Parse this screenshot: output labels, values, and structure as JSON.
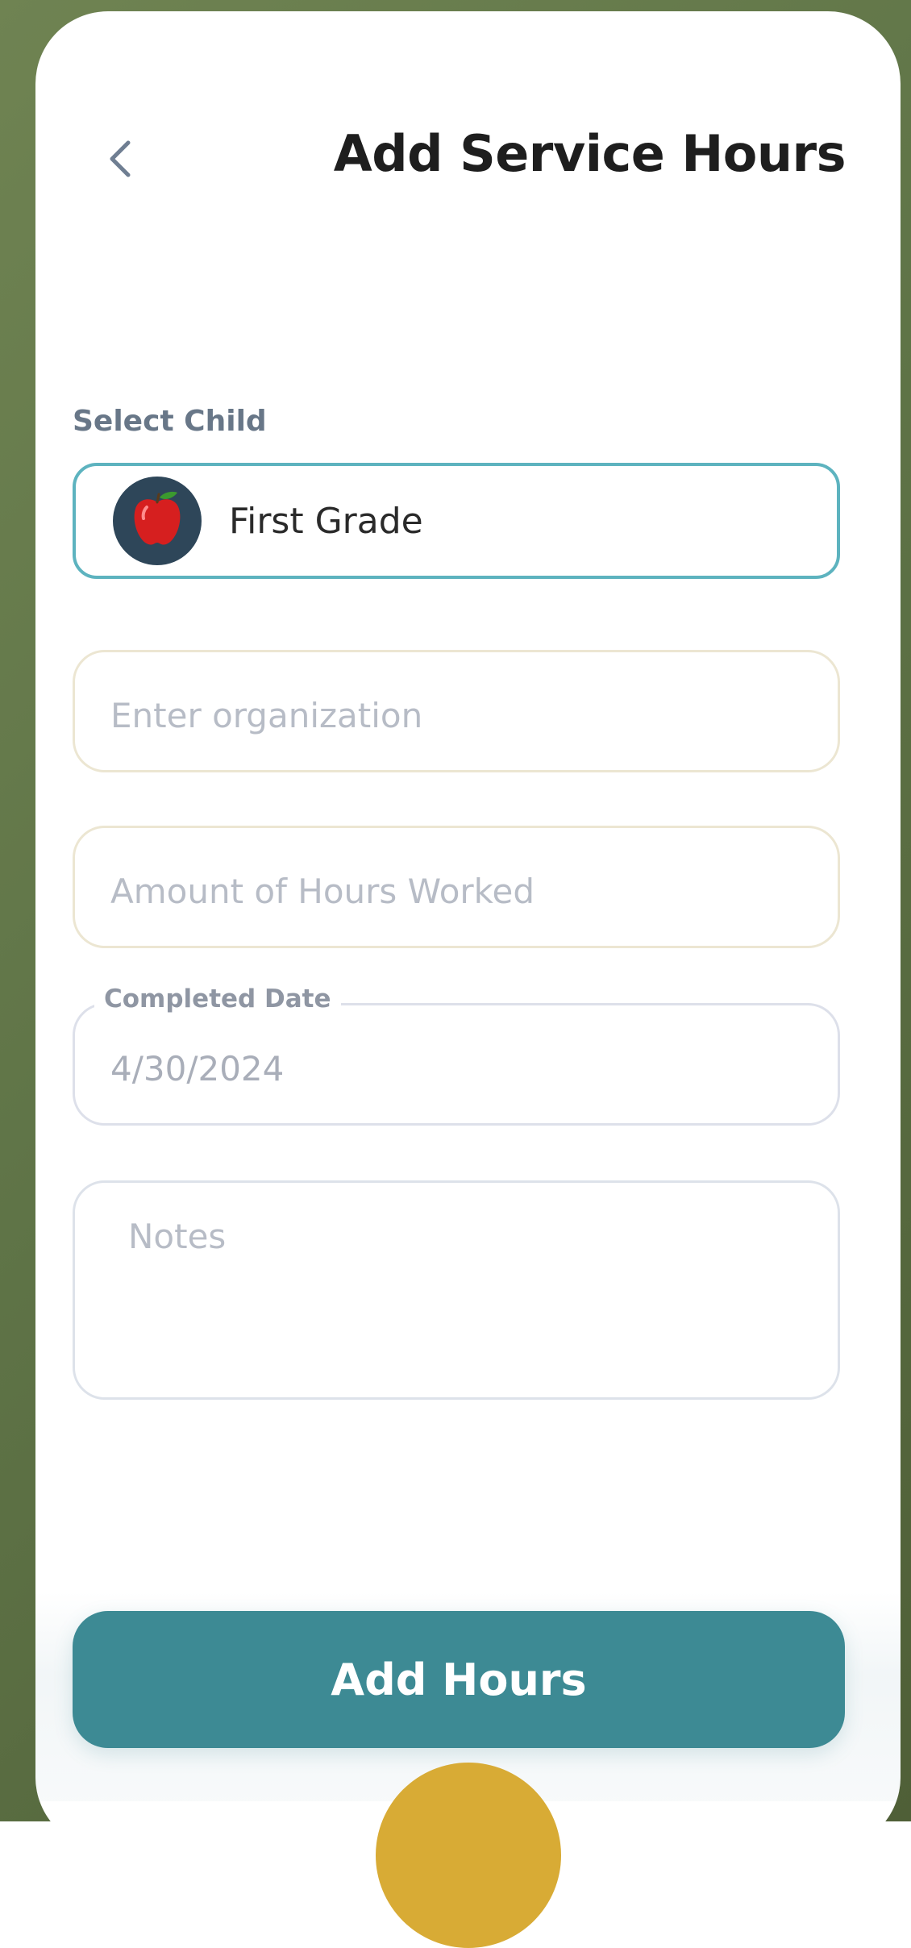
{
  "header": {
    "title": "Add Service Hours",
    "back_icon": "chevron-left-icon"
  },
  "select_child": {
    "label": "Select Child",
    "selected_name": "First Grade",
    "avatar_icon": "apple-icon"
  },
  "form": {
    "organization_placeholder": "Enter organization",
    "hours_placeholder": "Amount of Hours Worked",
    "completed_date_label": "Completed Date",
    "completed_date_value": "4/30/2024",
    "notes_placeholder": "Notes"
  },
  "actions": {
    "add_label": "Add Hours"
  },
  "colors": {
    "accent": "#3d8a94",
    "selected_border": "#5db3bf",
    "tab_circle": "#d8ab35"
  }
}
